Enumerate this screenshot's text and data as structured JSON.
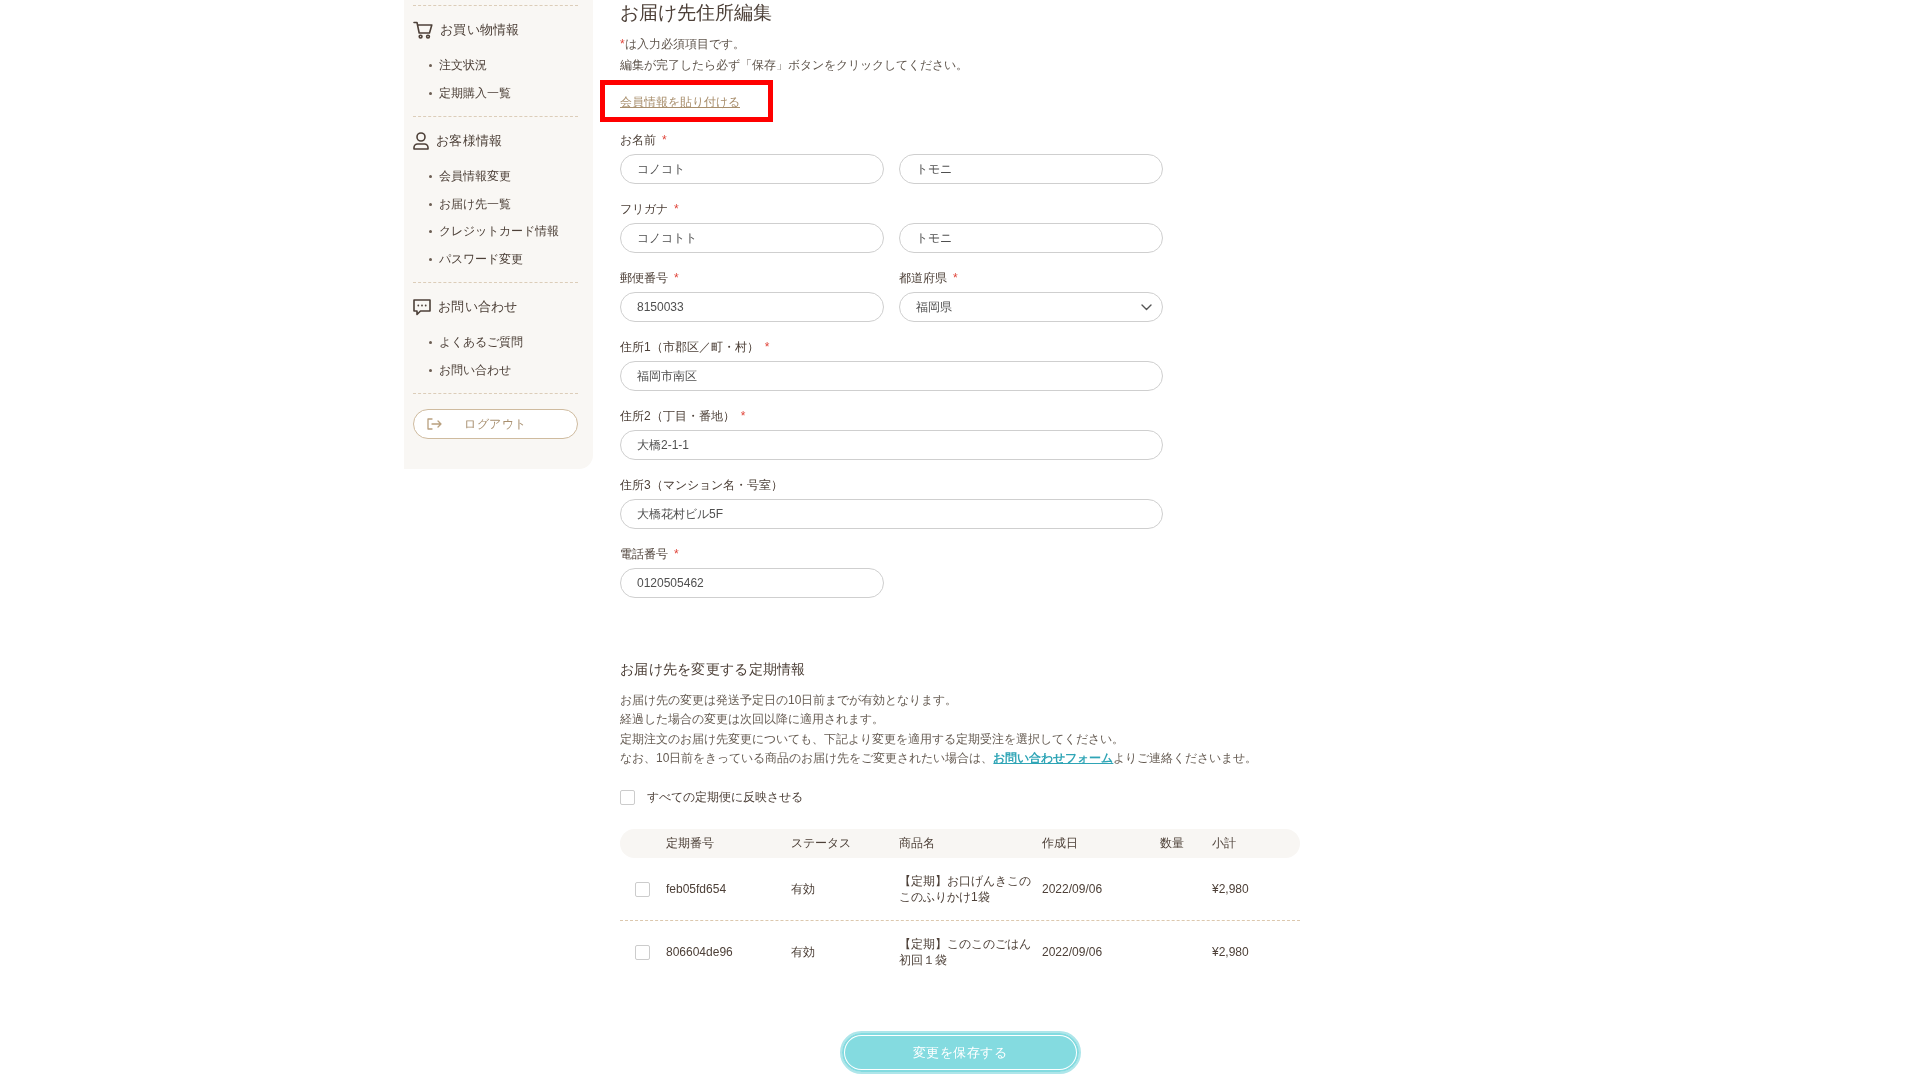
{
  "sidebar": {
    "sections": [
      {
        "kind": "cart",
        "heading": "お買い物情報",
        "items": [
          "注文状況",
          "定期購入一覧"
        ]
      },
      {
        "kind": "person",
        "heading": "お客様情報",
        "items": [
          "会員情報変更",
          "お届け先一覧",
          "クレジットカード情報",
          "パスワード変更"
        ]
      },
      {
        "kind": "chat",
        "heading": "お問い合わせ",
        "items": [
          "よくあるご質問",
          "お問い合わせ"
        ]
      }
    ],
    "logout_button": "ログアウト"
  },
  "page_title": "お届け先住所編集",
  "intro": [
    {
      "required_mark": "*",
      "text": "は入力必須項目です。"
    },
    {
      "text": "編集が完了したら必ず「保存」ボタンをクリックしてください。"
    }
  ],
  "paste_link": {
    "label": "会員情報を貼り付ける",
    "highlighted": true
  },
  "fields": [
    {
      "kind": "pair",
      "label": "お名前",
      "required_mark": "*",
      "inputs": [
        {
          "kind": "text",
          "value": "コノコト"
        },
        {
          "kind": "text",
          "value": "トモニ"
        }
      ]
    },
    {
      "kind": "pair",
      "label": "フリガナ",
      "required_mark": "*",
      "inputs": [
        {
          "kind": "text",
          "value": "コノコトト"
        },
        {
          "kind": "text",
          "value": "トモニ"
        }
      ]
    },
    {
      "kind": "short",
      "label": "郵便番号",
      "required_mark": "*",
      "inputs": [
        {
          "kind": "text",
          "value": "8150033"
        }
      ]
    },
    {
      "kind": "short",
      "label": "都道府県",
      "required_mark": "*",
      "inputs": [
        {
          "kind": "select",
          "value": "福岡県"
        }
      ]
    },
    {
      "kind": "long",
      "label": "住所1（市郡区／町・村）",
      "required_mark": "*",
      "inputs": [
        {
          "kind": "text",
          "value": "福岡市南区"
        }
      ]
    },
    {
      "kind": "long",
      "label": "住所2（丁目・番地）",
      "required_mark": "*",
      "inputs": [
        {
          "kind": "text",
          "value": "大橋2-1-1"
        }
      ]
    },
    {
      "kind": "long",
      "label": "住所3（マンション名・号室）",
      "inputs": [
        {
          "kind": "text",
          "value": "大橋花村ビル5F"
        }
      ]
    },
    {
      "kind": "short",
      "label": "電話番号",
      "required_mark": "*",
      "inputs": [
        {
          "kind": "text",
          "value": "0120505462"
        }
      ]
    }
  ],
  "subscription": {
    "heading": "お届け先を変更する定期情報",
    "notes": [
      {
        "text": "お届け先の変更は発送予定日の10日前までが有効となります。"
      },
      {
        "text": "経過した場合の変更は次回以降に適用されます。"
      },
      {
        "text": "定期注文のお届け先変更についても、下記より変更を適用する定期受注を選択してください。"
      },
      {
        "text": "なお、10日前をきっている商品のお届け先をご変更されたい場合は、",
        "link": "お問い合わせフォーム",
        "text_after": "よりご連絡くださいませ。"
      }
    ],
    "apply_all": {
      "label": "すべての定期便に反映させる",
      "checked": false
    },
    "table": {
      "columns": [
        "定期番号",
        "ステータス",
        "商品名",
        "作成日",
        "数量",
        "小計"
      ],
      "rows": [
        {
          "checked": false,
          "number": "feb05fd654",
          "status": "有効",
          "product": "【定期】お口げんきこのこのふりかけ1袋",
          "created": "2022/09/06",
          "subtotal": "¥2,980"
        },
        {
          "checked": false,
          "number": "806604de96",
          "status": "有効",
          "product": "【定期】このこのごはん初回１袋",
          "created": "2022/09/06",
          "subtotal": "¥2,980"
        }
      ]
    }
  },
  "save_button": "変更を保存する"
}
